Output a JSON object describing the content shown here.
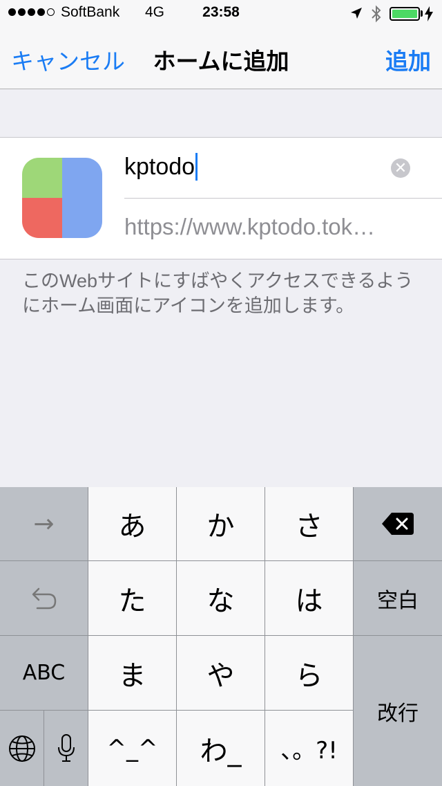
{
  "status_bar": {
    "signal": "●●●●○",
    "carrier": "SoftBank",
    "network": "4G",
    "time": "23:58",
    "battery_level": 1.0
  },
  "nav": {
    "cancel_label": "キャンセル",
    "title": "ホームに追加",
    "add_label": "追加"
  },
  "bookmark": {
    "name_value": "kptodo",
    "url": "https://www.kptodo.tok…",
    "icon_colors": {
      "top_left": "#9ed778",
      "bottom_left": "#ee6860",
      "right": "#7fa6f0"
    }
  },
  "description": "このWebサイトにすばやくアクセスできるようにホーム画面にアイコンを追加します。",
  "keyboard": {
    "arrow": "→",
    "kana_a": "あ",
    "kana_ka": "か",
    "kana_sa": "さ",
    "kana_ta": "た",
    "kana_na": "な",
    "kana_ha": "は",
    "space": "空白",
    "abc": "ABC",
    "kana_ma": "ま",
    "kana_ya": "や",
    "kana_ra": "ら",
    "return": "改行",
    "face": "^_^",
    "kana_wa": "わ_",
    "punct": "、。?!"
  },
  "colors": {
    "accent": "#1a7cf4",
    "battery": "#4cd964"
  }
}
